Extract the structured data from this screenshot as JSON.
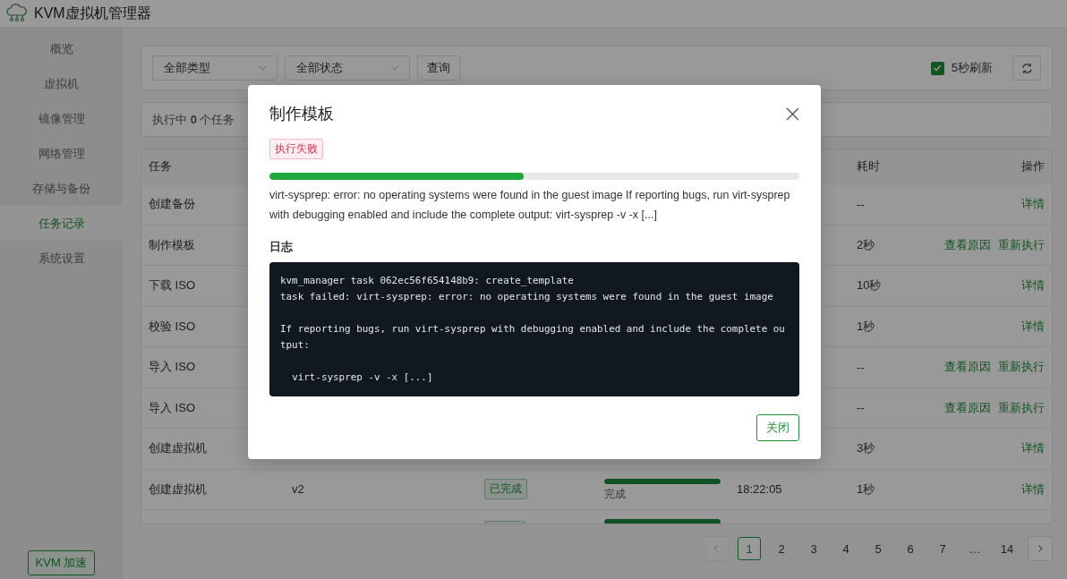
{
  "app": {
    "title": "KVM虚拟机管理器"
  },
  "sidebar": {
    "items": [
      {
        "label": "概览",
        "selected": false
      },
      {
        "label": "虚拟机",
        "selected": false
      },
      {
        "label": "镜像管理",
        "selected": false
      },
      {
        "label": "网络管理",
        "selected": false
      },
      {
        "label": "存储与备份",
        "selected": false
      },
      {
        "label": "任务记录",
        "selected": true
      },
      {
        "label": "系统设置",
        "selected": false
      }
    ],
    "footer_button": "KVM 加速"
  },
  "filters": {
    "type_select": "全部类型",
    "status_select": "全部状态",
    "query_button": "查询",
    "auto_refresh": {
      "label": "5秒刷新",
      "checked": true
    }
  },
  "status_bar": {
    "prefix": "执行中",
    "count": "0",
    "suffix": "个任务"
  },
  "table": {
    "columns": [
      {
        "label": "任务"
      },
      {
        "label": "耗时"
      },
      {
        "label": "操作"
      }
    ],
    "rows": [
      {
        "task": "创建备份",
        "duration": "--",
        "actions": [
          "详情"
        ]
      },
      {
        "task": "制作模板",
        "duration": "2秒",
        "actions": [
          "查看原因",
          "重新执行"
        ]
      },
      {
        "task": "下载 ISO",
        "duration": "10秒",
        "actions": [
          "详情"
        ]
      },
      {
        "task": "校验 ISO",
        "duration": "1秒",
        "actions": [
          "详情"
        ]
      },
      {
        "task": "导入 ISO",
        "duration": "--",
        "actions": [
          "查看原因",
          "重新执行"
        ]
      },
      {
        "task": "导入 ISO",
        "duration": "--",
        "actions": [
          "查看原因",
          "重新执行"
        ]
      },
      {
        "task": "创建虚拟机",
        "duration": "3秒",
        "actions": [
          "详情"
        ]
      },
      {
        "task": "创建虚拟机",
        "target": "v2",
        "status": {
          "kind": "done",
          "label": "已完成"
        },
        "progress": {
          "level": 1,
          "label": "完成"
        },
        "time": "18:22:05",
        "duration": "1秒",
        "actions": [
          "详情"
        ]
      },
      {
        "status": {
          "kind": "done"
        },
        "progress": {
          "level": 1
        }
      }
    ]
  },
  "pagination": {
    "prev_disabled": true,
    "pages": [
      {
        "label": "1",
        "selected": true
      },
      {
        "label": "2",
        "selected": false
      },
      {
        "label": "3",
        "selected": false
      },
      {
        "label": "4",
        "selected": false
      },
      {
        "label": "5",
        "selected": false
      },
      {
        "label": "6",
        "selected": false
      },
      {
        "label": "7",
        "selected": false
      },
      {
        "label": "…",
        "selected": false
      },
      {
        "label": "14",
        "selected": false
      }
    ]
  },
  "dialog": {
    "title": "制作模板",
    "status": {
      "kind": "failed",
      "label": "执行失败"
    },
    "progress": {
      "level": 0.48
    },
    "message": "virt-sysprep: error: no operating systems were found in the guest image If reporting bugs, run virt-sysprep with debugging enabled and include the complete output: virt-sysprep -v -x [...]",
    "log_label": "日志",
    "log": "kvm_manager task 062ec56f654148b9: create_template\ntask failed: virt-sysprep: error: no operating systems were found in the guest image\n\nIf reporting bugs, run virt-sysprep with debugging enabled and include the complete output:\n\n  virt-sysprep -v -x [...]",
    "close_button": "关闭"
  }
}
